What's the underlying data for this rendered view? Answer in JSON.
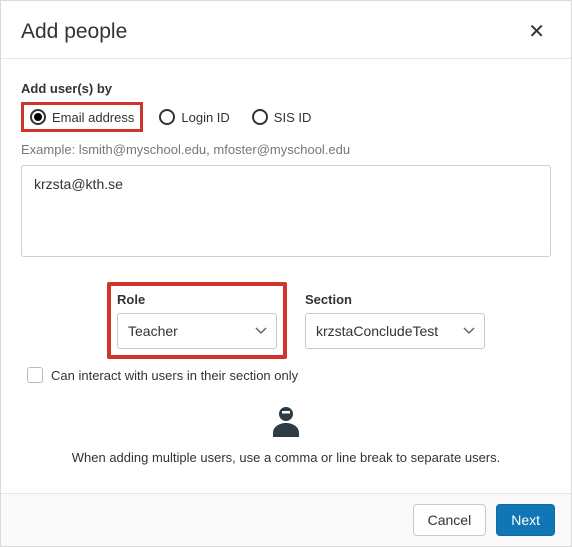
{
  "header": {
    "title": "Add people"
  },
  "form": {
    "group_label": "Add user(s) by",
    "radios": {
      "email": "Email address",
      "login": "Login ID",
      "sis": "SIS ID"
    },
    "example": "Example: lsmith@myschool.edu, mfoster@myschool.edu",
    "textarea_value": "krzsta@kth.se",
    "role": {
      "label": "Role",
      "value": "Teacher"
    },
    "section": {
      "label": "Section",
      "value": "krzstaConcludeTest"
    },
    "checkbox_label": "Can interact with users in their section only",
    "info_text": "When adding multiple users, use a comma or line break to separate users."
  },
  "footer": {
    "cancel": "Cancel",
    "next": "Next"
  }
}
